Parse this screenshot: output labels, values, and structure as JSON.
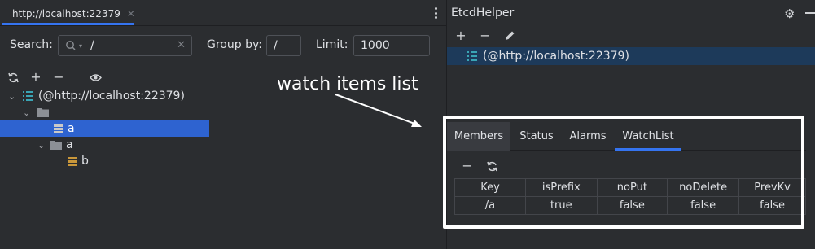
{
  "left": {
    "tab": {
      "title": "http://localhost:22379",
      "icon": "etcd-logo-icon",
      "close_icon": "close-icon"
    },
    "more_menu_icon": "kebab-menu-icon",
    "search": {
      "label": "Search:",
      "value": "/",
      "icon": "search-icon"
    },
    "group_by": {
      "label": "Group by:",
      "value": "/"
    },
    "limit": {
      "label": "Limit:",
      "value": "1000"
    },
    "toolbar": [
      "refresh-icon",
      "add-icon",
      "remove-icon",
      "watch-eye-icon"
    ],
    "tree": [
      {
        "label": "(@http://localhost:22379)",
        "level": 0,
        "expanded": true,
        "icon": "server-list-icon"
      },
      {
        "label": "",
        "level": 1,
        "expanded": true,
        "icon": "folder-icon"
      },
      {
        "label": "a",
        "level": 2,
        "selected": true,
        "icon": "key-value-icon"
      },
      {
        "label": "a",
        "level": 2,
        "expanded": true,
        "icon": "folder-icon"
      },
      {
        "label": "b",
        "level": 3,
        "icon": "key-value-icon"
      }
    ]
  },
  "right": {
    "title": "EtcdHelper",
    "header_icons": [
      "settings-gear-icon",
      "minimize-icon"
    ],
    "toolbar": [
      "add-icon",
      "remove-icon",
      "edit-pencil-icon"
    ],
    "server_item": "(@http://localhost:22379)",
    "panel": {
      "tabs": [
        "Members",
        "Status",
        "Alarms",
        "WatchList"
      ],
      "active_tab": "WatchList",
      "toolbar": [
        "remove-icon",
        "refresh-icon"
      ],
      "table": {
        "columns": [
          "Key",
          "isPrefix",
          "noPut",
          "noDelete",
          "PrevKv"
        ],
        "rows": [
          [
            "/a",
            "true",
            "false",
            "false",
            "false"
          ]
        ]
      }
    }
  },
  "annotation": {
    "text": "watch items list"
  },
  "colors": {
    "background": "#2b2d30",
    "accent": "#3574f0",
    "selection": "#2e63d0",
    "server_selection": "#1d3a5a",
    "tree_icon_teal": "#3aa5b5",
    "key_icon_orange": "#c9973a"
  }
}
